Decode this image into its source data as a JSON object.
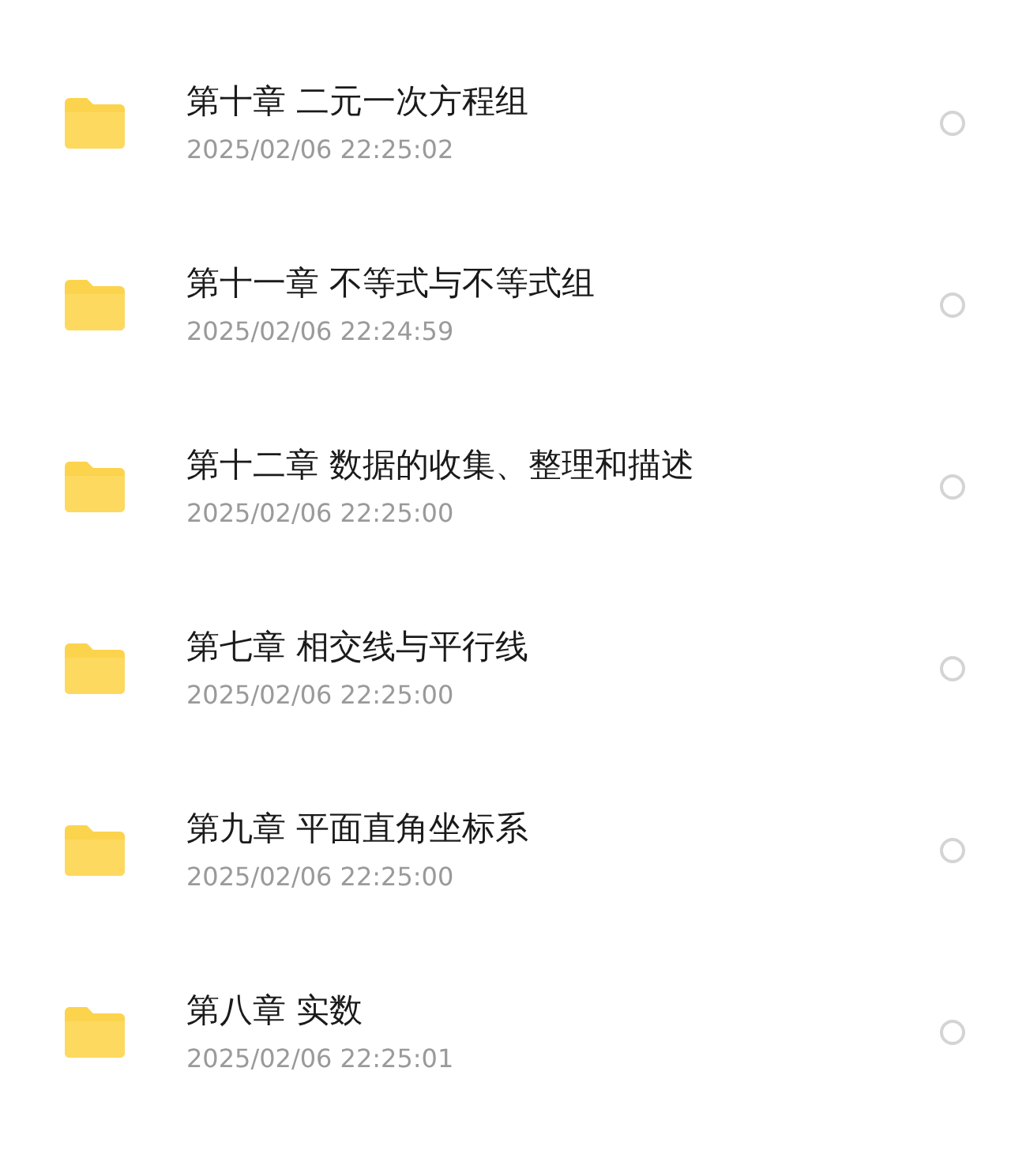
{
  "folders": [
    {
      "name": "第十章 二元一次方程组",
      "modified": "2025/02/06 22:25:02",
      "selected": false
    },
    {
      "name": "第十一章 不等式与不等式组",
      "modified": "2025/02/06 22:24:59",
      "selected": false
    },
    {
      "name": "第十二章 数据的收集、整理和描述",
      "modified": "2025/02/06 22:25:00",
      "selected": false
    },
    {
      "name": "第七章 相交线与平行线",
      "modified": "2025/02/06 22:25:00",
      "selected": false
    },
    {
      "name": "第九章 平面直角坐标系",
      "modified": "2025/02/06 22:25:00",
      "selected": false
    },
    {
      "name": "第八章 实数",
      "modified": "2025/02/06 22:25:01",
      "selected": false
    }
  ]
}
